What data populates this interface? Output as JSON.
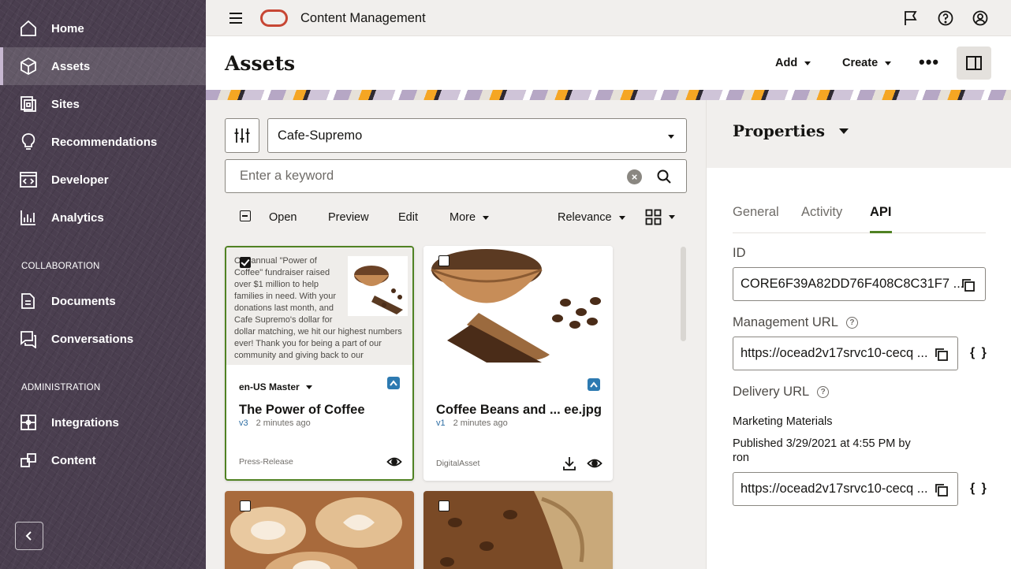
{
  "sidebar": {
    "items": [
      {
        "label": "Home",
        "icon": "home-icon"
      },
      {
        "label": "Assets",
        "icon": "cube-icon",
        "active": true
      },
      {
        "label": "Sites",
        "icon": "sites-icon"
      },
      {
        "label": "Recommendations",
        "icon": "lightbulb-icon"
      },
      {
        "label": "Developer",
        "icon": "code-icon"
      },
      {
        "label": "Analytics",
        "icon": "bar-chart-icon"
      }
    ],
    "collaboration_heading": "COLLABORATION",
    "collaboration_items": [
      {
        "label": "Documents",
        "icon": "documents-icon"
      },
      {
        "label": "Conversations",
        "icon": "conversations-icon"
      }
    ],
    "administration_heading": "ADMINISTRATION",
    "administration_items": [
      {
        "label": "Integrations",
        "icon": "integrations-icon"
      },
      {
        "label": "Content",
        "icon": "content-icon"
      }
    ],
    "collapse_icon": "chevron-left-icon"
  },
  "header": {
    "app_title": "Content Management",
    "icons": [
      "flag-icon",
      "help-icon",
      "user-icon"
    ]
  },
  "page": {
    "title": "Assets",
    "add_label": "Add",
    "create_label": "Create"
  },
  "filters": {
    "repository": "Cafe-Supremo",
    "search_placeholder": "Enter a keyword"
  },
  "toolbar": {
    "open": "Open",
    "preview": "Preview",
    "edit": "Edit",
    "more": "More",
    "sort": "Relevance"
  },
  "cards": [
    {
      "preview_text": "Our annual \"Power of Coffee\" fundraiser raised over $1 million to help families in need. With your donations last month, and Cafe Supremo's dollar for dollar matching, we hit our highest numbers ever! Thank you for being a part of our community and giving back to our",
      "language": "en-US Master",
      "title": "The Power of Coffee",
      "version": "v3",
      "time": "2 minutes ago",
      "type": "Press-Release",
      "selected": true
    },
    {
      "title": "Coffee Beans and ... ee.jpg",
      "version": "v1",
      "time": "2 minutes ago",
      "type": "DigitalAsset",
      "selected": false
    }
  ],
  "properties": {
    "title": "Properties",
    "tabs": [
      "General",
      "Activity",
      "API"
    ],
    "active_tab": "API",
    "id_label": "ID",
    "id_value": "CORE6F39A82DD76F408C8C31F7 ...",
    "management_url_label": "Management URL",
    "management_url": "https://ocead2v17srvc10-cecq ...",
    "delivery_url_label": "Delivery URL",
    "channel": "Marketing Materials",
    "published_line1": "Published 3/29/2021 at 4:55 PM by",
    "published_line2": "ron",
    "delivery_url": "https://ocead2v17srvc10-cecq ...",
    "braces": "{ }"
  },
  "colors": {
    "sidebar_bg": "#4a3e4f",
    "selected_border": "#508223",
    "oracle_red": "#c74634",
    "version_blue": "#2d6da3"
  }
}
